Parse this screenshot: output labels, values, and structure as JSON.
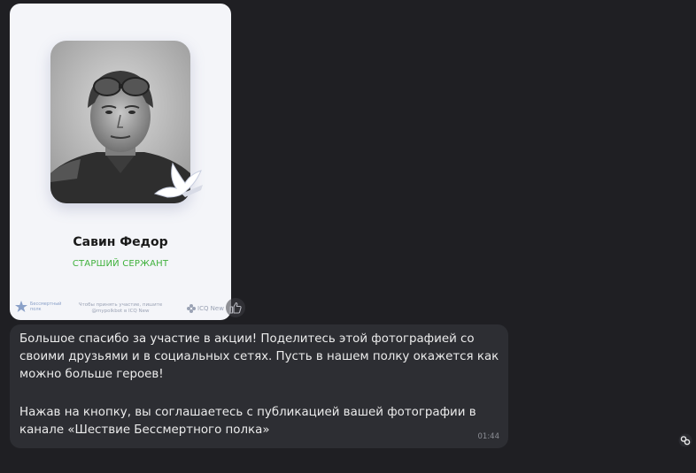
{
  "card": {
    "name": "Савин Федор",
    "rank": "СТАРШИЙ СЕРЖАНТ",
    "footer": {
      "logo_text": "Бессмертный полк",
      "note": "Чтобы принять участие, пишите @mypolkbot в ICQ New",
      "icq_label": "ICQ New"
    }
  },
  "message": {
    "paragraph1": "Большое спасибо за участие в акции! Поделитесь этой фотографией со своими друзьями и в социальных сетях. Пусть в нашем полку окажется как можно больше героев!",
    "paragraph2": "Нажав на кнопку, вы соглашаетесь с публикацией вашей фотографии в канале «Шествие Бессмертного полка»",
    "time": "01:44"
  },
  "icons": {
    "reaction": "thumbs-up-icon",
    "bot": "bot-icon",
    "dove": "dove-icon"
  },
  "colors": {
    "background": "#1f1f23",
    "bubble": "#2d2e33",
    "rank_green": "#3fb13c"
  }
}
